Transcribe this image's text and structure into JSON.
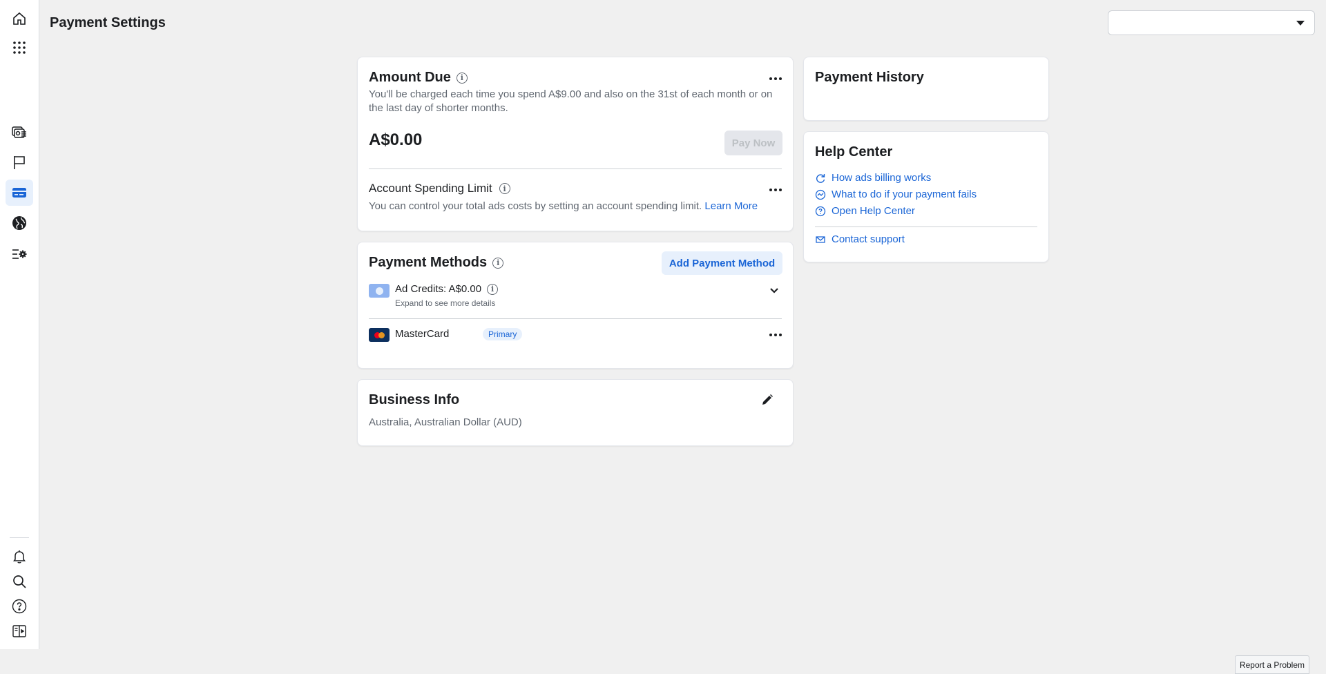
{
  "header": {
    "title": "Payment Settings",
    "account_select_value": ""
  },
  "sidebar": {
    "items": [
      {
        "name": "home-icon"
      },
      {
        "name": "apps-grid-icon"
      },
      {
        "name": "ads-manager-icon"
      },
      {
        "name": "flag-icon"
      },
      {
        "name": "billing-card-icon",
        "active": true
      },
      {
        "name": "globe-icon"
      },
      {
        "name": "settings-icon"
      },
      {
        "name": "bell-icon"
      },
      {
        "name": "search-icon"
      },
      {
        "name": "help-icon"
      },
      {
        "name": "panel-toggle-icon"
      }
    ]
  },
  "amount_due": {
    "title": "Amount Due",
    "description": "You'll be charged each time you spend A$9.00 and also on the 31st of each month or on the last day of shorter months.",
    "amount": "A$0.00",
    "pay_now_label": "Pay Now",
    "spending_limit_title": "Account Spending Limit",
    "spending_limit_desc": "You can control your total ads costs by setting an account spending limit.",
    "learn_more_label": "Learn More"
  },
  "payment_methods": {
    "title": "Payment Methods",
    "add_label": "Add Payment Method",
    "ad_credits_label": "Ad Credits: A$0.00",
    "ad_credits_sub": "Expand to see more details",
    "card_name": "MasterCard",
    "primary_badge": "Primary"
  },
  "business_info": {
    "title": "Business Info",
    "value": "Australia, Australian Dollar (AUD)"
  },
  "payment_history": {
    "title": "Payment History"
  },
  "help_center": {
    "title": "Help Center",
    "links": [
      "How ads billing works",
      "What to do if your payment fails",
      "Open Help Center"
    ],
    "contact_label": "Contact support"
  },
  "footer": {
    "report_label": "Report a Problem"
  },
  "colors": {
    "accent": "#1a65d6",
    "accent_light": "#e7f0fc",
    "page_bg": "#f0f0f0"
  }
}
